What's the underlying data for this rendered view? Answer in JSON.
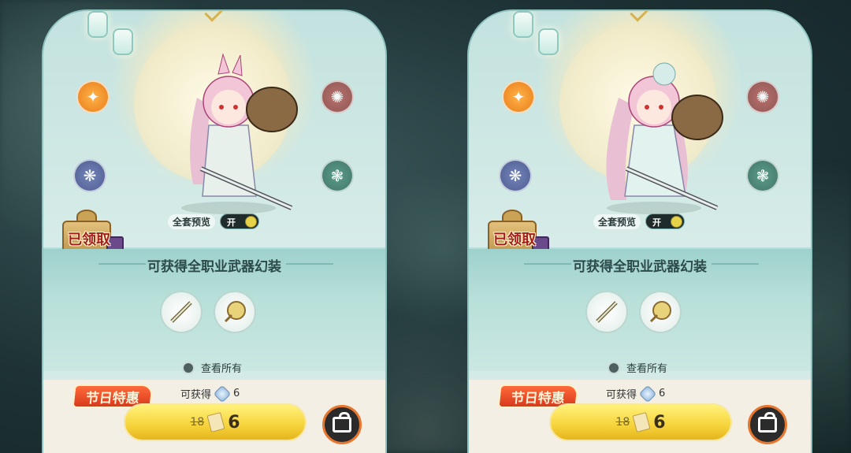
{
  "panels": [
    {
      "id": "left",
      "gift_status": "已领取",
      "preview_label": "全套预览",
      "toggle_state": "开",
      "section_title": "可获得全职业武器幻装",
      "view_all_label": "查看所有",
      "promo_badge": "节日特惠",
      "obtain_label": "可获得",
      "obtain_count": "6",
      "old_price": "18",
      "new_price": "6"
    },
    {
      "id": "right",
      "gift_status": "已领取",
      "preview_label": "全套预览",
      "toggle_state": "开",
      "section_title": "可获得全职业武器幻装",
      "view_all_label": "查看所有",
      "promo_badge": "节日特惠",
      "obtain_label": "可获得",
      "obtain_count": "6",
      "old_price": "18",
      "new_price": "6"
    }
  ],
  "icons": {
    "emblem_top_left": "orange-class-emblem-icon",
    "emblem_top_right": "red-class-emblem-icon",
    "emblem_bottom_left": "blue-class-emblem-icon",
    "emblem_bottom_right": "green-class-emblem-icon",
    "shop": "shop-bag-icon",
    "gem": "crystal-gem-icon",
    "ticket": "ticket-icon"
  },
  "colors": {
    "panel_bg": "#b6dcd9",
    "promo_red": "#d8391c",
    "price_yellow": "#f6d33b",
    "toggle_knob": "#e6d34a",
    "shop_ring": "#e7762f"
  }
}
